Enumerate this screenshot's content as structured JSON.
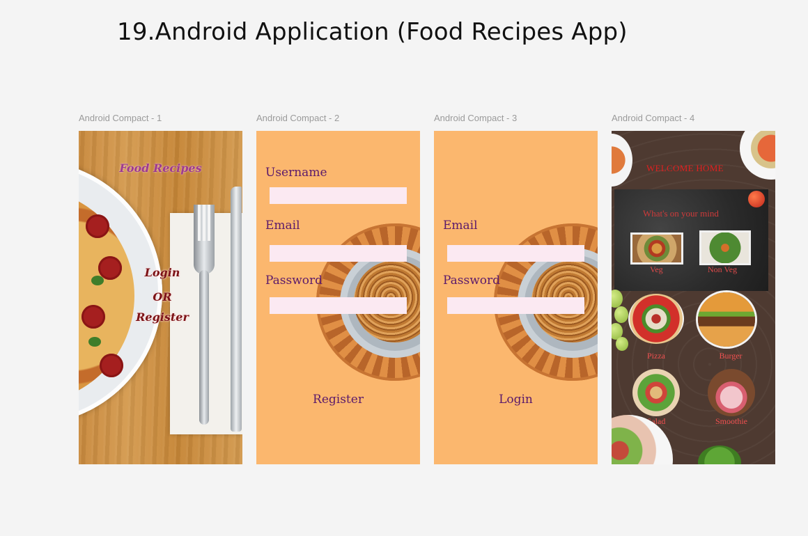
{
  "page": {
    "title": "19.Android Application  (Food Recipes App)"
  },
  "frames": [
    {
      "label": "Android Compact - 1"
    },
    {
      "label": "Android Compact - 2"
    },
    {
      "label": "Android Compact - 3"
    },
    {
      "label": "Android Compact - 4"
    }
  ],
  "splash": {
    "title": "Food Recipes",
    "login": "Login",
    "or": "OR",
    "register": "Register"
  },
  "register_screen": {
    "username_label": "Username",
    "username_value": "",
    "email_label": "Email",
    "email_value": "",
    "password_label": "Password",
    "password_value": "",
    "submit_label": "Register"
  },
  "login_screen": {
    "email_label": "Email",
    "email_value": "",
    "password_label": "Password",
    "password_value": "",
    "submit_label": "Login"
  },
  "home_screen": {
    "welcome": "WELCOME HOME",
    "prompt": "What's on your mind",
    "categories": [
      {
        "label": "Veg"
      },
      {
        "label": "Non Veg"
      }
    ],
    "dishes": [
      {
        "label": "Pizza"
      },
      {
        "label": "Burger"
      },
      {
        "label": "Salad"
      },
      {
        "label": "Smoothie"
      }
    ]
  },
  "colors": {
    "splash_title": "#9e3b8e",
    "form_bg": "#fbb76e",
    "form_text": "#5b1a6b",
    "home_bg": "#4e3a31",
    "home_accent": "#e02020"
  }
}
